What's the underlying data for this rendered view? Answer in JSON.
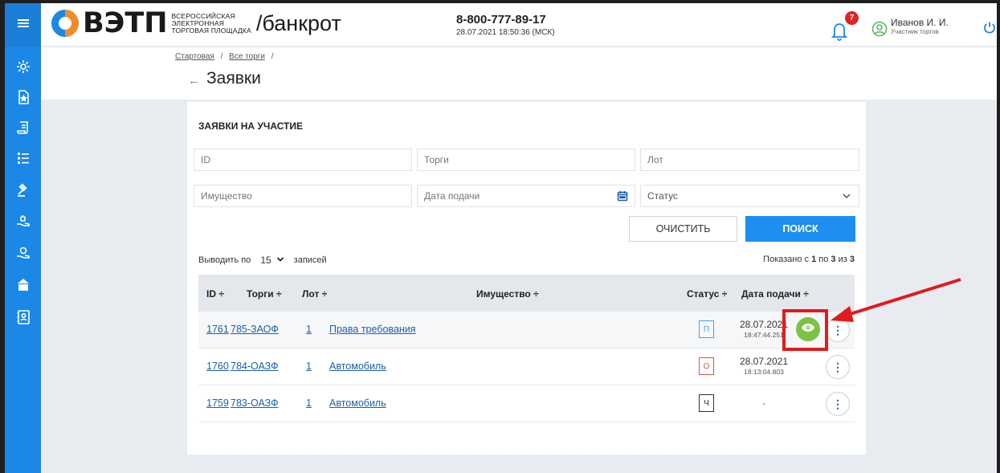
{
  "header": {
    "logo_main": "ВЭТП",
    "logo_sub": [
      "ВСЕРОССИЙСКАЯ",
      "ЭЛЕКТРОННАЯ",
      "ТОРГОВАЯ ПЛОЩАДКА"
    ],
    "logo_section": "/банкрот",
    "phone": "8-800-777-89-17",
    "datetime": "28.07.2021 18:50:36 (МСК)",
    "notifications_count": "7",
    "user_name": "Иванов И. И.",
    "user_role": "Участник торгов"
  },
  "sidebar": {
    "items": [
      {
        "icon": "menu-icon"
      },
      {
        "icon": "gear-icon"
      },
      {
        "icon": "document-star-icon"
      },
      {
        "icon": "scroll-icon"
      },
      {
        "icon": "list-icon"
      },
      {
        "icon": "gavel-icon"
      },
      {
        "icon": "hand-icon"
      },
      {
        "icon": "hand-bag-icon"
      },
      {
        "icon": "bank-icon"
      },
      {
        "icon": "contacts-icon"
      }
    ]
  },
  "breadcrumb": {
    "items": [
      "Стартовая",
      "Все торги"
    ],
    "separator": "/"
  },
  "page": {
    "title": "Заявки"
  },
  "filters": {
    "card_title": "ЗАЯВКИ НА УЧАСТИЕ",
    "id_placeholder": "ID",
    "torgi_placeholder": "Торги",
    "lot_placeholder": "Лот",
    "property_placeholder": "Имущество",
    "date_placeholder": "Дата подачи",
    "status_placeholder": "Статус",
    "clear_label": "ОЧИСТИТЬ",
    "search_label": "ПОИСК"
  },
  "pagination": {
    "show_prefix": "Выводить по",
    "per_page": "15",
    "show_suffix": "записей",
    "shown_prefix": "Показано с",
    "from": "1",
    "to_word": "по",
    "to": "3",
    "of_word": "из",
    "total": "3"
  },
  "table": {
    "headers": {
      "id": "ID ÷",
      "torgi": "Торги ÷",
      "lot": "Лот ÷",
      "property": "Имущество ÷",
      "status": "Статус ÷",
      "date": "Дата подачи ÷"
    },
    "rows": [
      {
        "id": "1761",
        "torgi": "785-ЗАОФ",
        "lot": "1",
        "property": "Права требования",
        "status": "П",
        "status_color": "#4aa3df",
        "date": "28.07.2021",
        "time": "18:47:44.251"
      },
      {
        "id": "1760",
        "torgi": "784-ОАЗФ",
        "lot": "1",
        "property": "Автомобиль",
        "status": "О",
        "status_color": "#d9534f",
        "date": "28.07.2021",
        "time": "18:13:04.803"
      },
      {
        "id": "1759",
        "torgi": "783-ОАЗФ",
        "lot": "1",
        "property": "Автомобиль",
        "status": "Ч",
        "status_color": "#333333",
        "date": "-",
        "time": ""
      }
    ]
  },
  "colors": {
    "accent": "#1e8ef0",
    "sidebar": "#1a88e4",
    "highlight": "#e21b1b",
    "eye_button": "#7cc247"
  }
}
